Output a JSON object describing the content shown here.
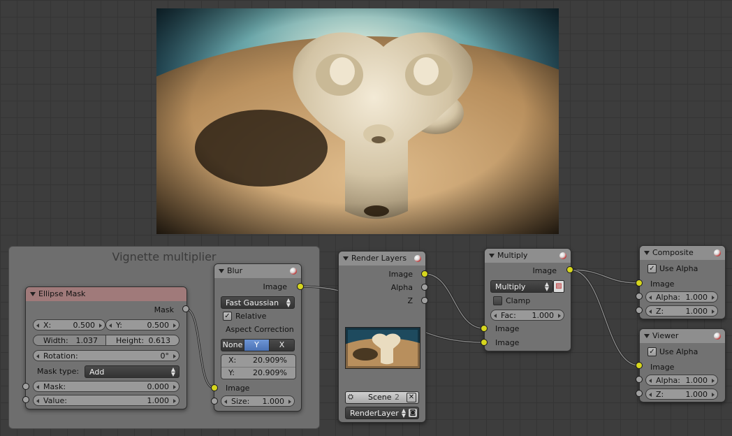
{
  "frame": {
    "label": "Vignette multiplier"
  },
  "ellipse_mask": {
    "title": "Ellipse Mask",
    "output_mask": "Mask",
    "x_label": "X:",
    "x_value": "0.500",
    "y_label": "Y:",
    "y_value": "0.500",
    "width_label": "Width:",
    "width_value": "1.037",
    "height_label": "Height:",
    "height_value": "0.613",
    "rotation_label": "Rotation:",
    "rotation_value": "0°",
    "mask_type_label": "Mask type:",
    "mask_type_value": "Add",
    "mask_input_label": "Mask:",
    "mask_input_value": "0.000",
    "value_label": "Value:",
    "value_value": "1.000"
  },
  "blur": {
    "title": "Blur",
    "output_image": "Image",
    "filter_type": "Fast Gaussian",
    "relative_label": "Relative",
    "aspect_label": "Aspect Correction",
    "aspect_options": [
      "None",
      "Y",
      "X"
    ],
    "aspect_selected": "Y",
    "x_label": "X:",
    "x_value": "20.909%",
    "y_label": "Y:",
    "y_value": "20.909%",
    "input_image": "Image",
    "size_label": "Size:",
    "size_value": "1.000"
  },
  "render_layers": {
    "title": "Render Layers",
    "out_image": "Image",
    "out_alpha": "Alpha",
    "out_z": "Z",
    "scene_label": "Scene",
    "scene_users": "2",
    "layer_value": "RenderLayer"
  },
  "multiply": {
    "title": "Multiply",
    "output_image": "Image",
    "blend_type": "Multiply",
    "clamp_label": "Clamp",
    "fac_label": "Fac:",
    "fac_value": "1.000",
    "input_image_1": "Image",
    "input_image_2": "Image"
  },
  "composite": {
    "title": "Composite",
    "use_alpha_label": "Use Alpha",
    "image_label": "Image",
    "alpha_label": "Alpha:",
    "alpha_value": "1.000",
    "z_label": "Z:",
    "z_value": "1.000"
  },
  "viewer": {
    "title": "Viewer",
    "use_alpha_label": "Use Alpha",
    "image_label": "Image",
    "alpha_label": "Alpha:",
    "alpha_value": "1.000",
    "z_label": "Z:",
    "z_value": "1.000"
  },
  "colors": {
    "socket_image": "#d6d61e",
    "socket_value": "#a0a0a0",
    "selected_segment": "#5a82c4",
    "link": "#6a6a6a"
  }
}
